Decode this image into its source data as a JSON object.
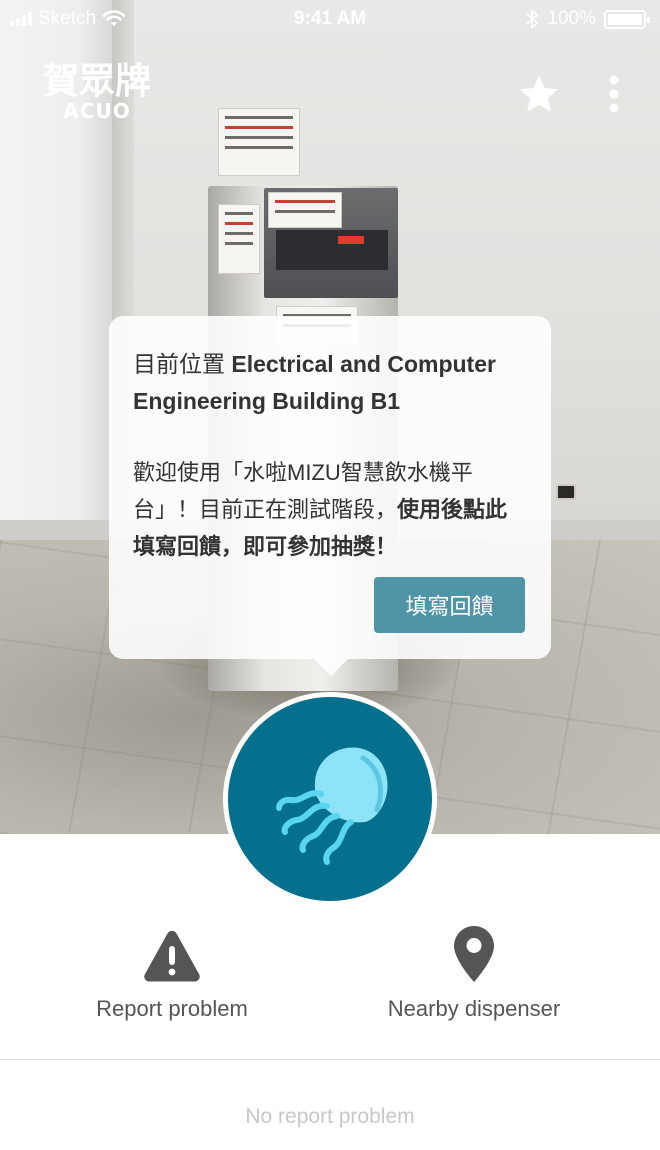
{
  "status_bar": {
    "carrier": "Sketch",
    "time": "9:41 AM",
    "battery": "100%"
  },
  "header": {
    "logo_cn": "賀眾牌",
    "logo_en": "ACUO",
    "star_icon": "star-icon",
    "more_icon": "more-vertical-icon"
  },
  "bubble": {
    "location_prefix": "目前位置",
    "location_name": "Electrical and Computer Engineering Building B1",
    "welcome_text": "歡迎使用「水啦MIZU智慧飲水機平台」！目前正在測試階段，",
    "welcome_bold": "使用後點此填寫回饋，即可參加抽獎！",
    "feedback_button": "填寫回饋"
  },
  "center_logo": {
    "icon": "jellyfish-icon",
    "color": "#05708d"
  },
  "actions": {
    "report_label": "Report problem",
    "report_icon": "warning-icon",
    "nearby_label": "Nearby dispenser",
    "nearby_icon": "map-pin-icon"
  },
  "footer": {
    "no_report": "No report problem"
  },
  "colors": {
    "accent_button": "#4f94a7",
    "brand_teal": "#05708d",
    "icon_gray": "#555555"
  }
}
